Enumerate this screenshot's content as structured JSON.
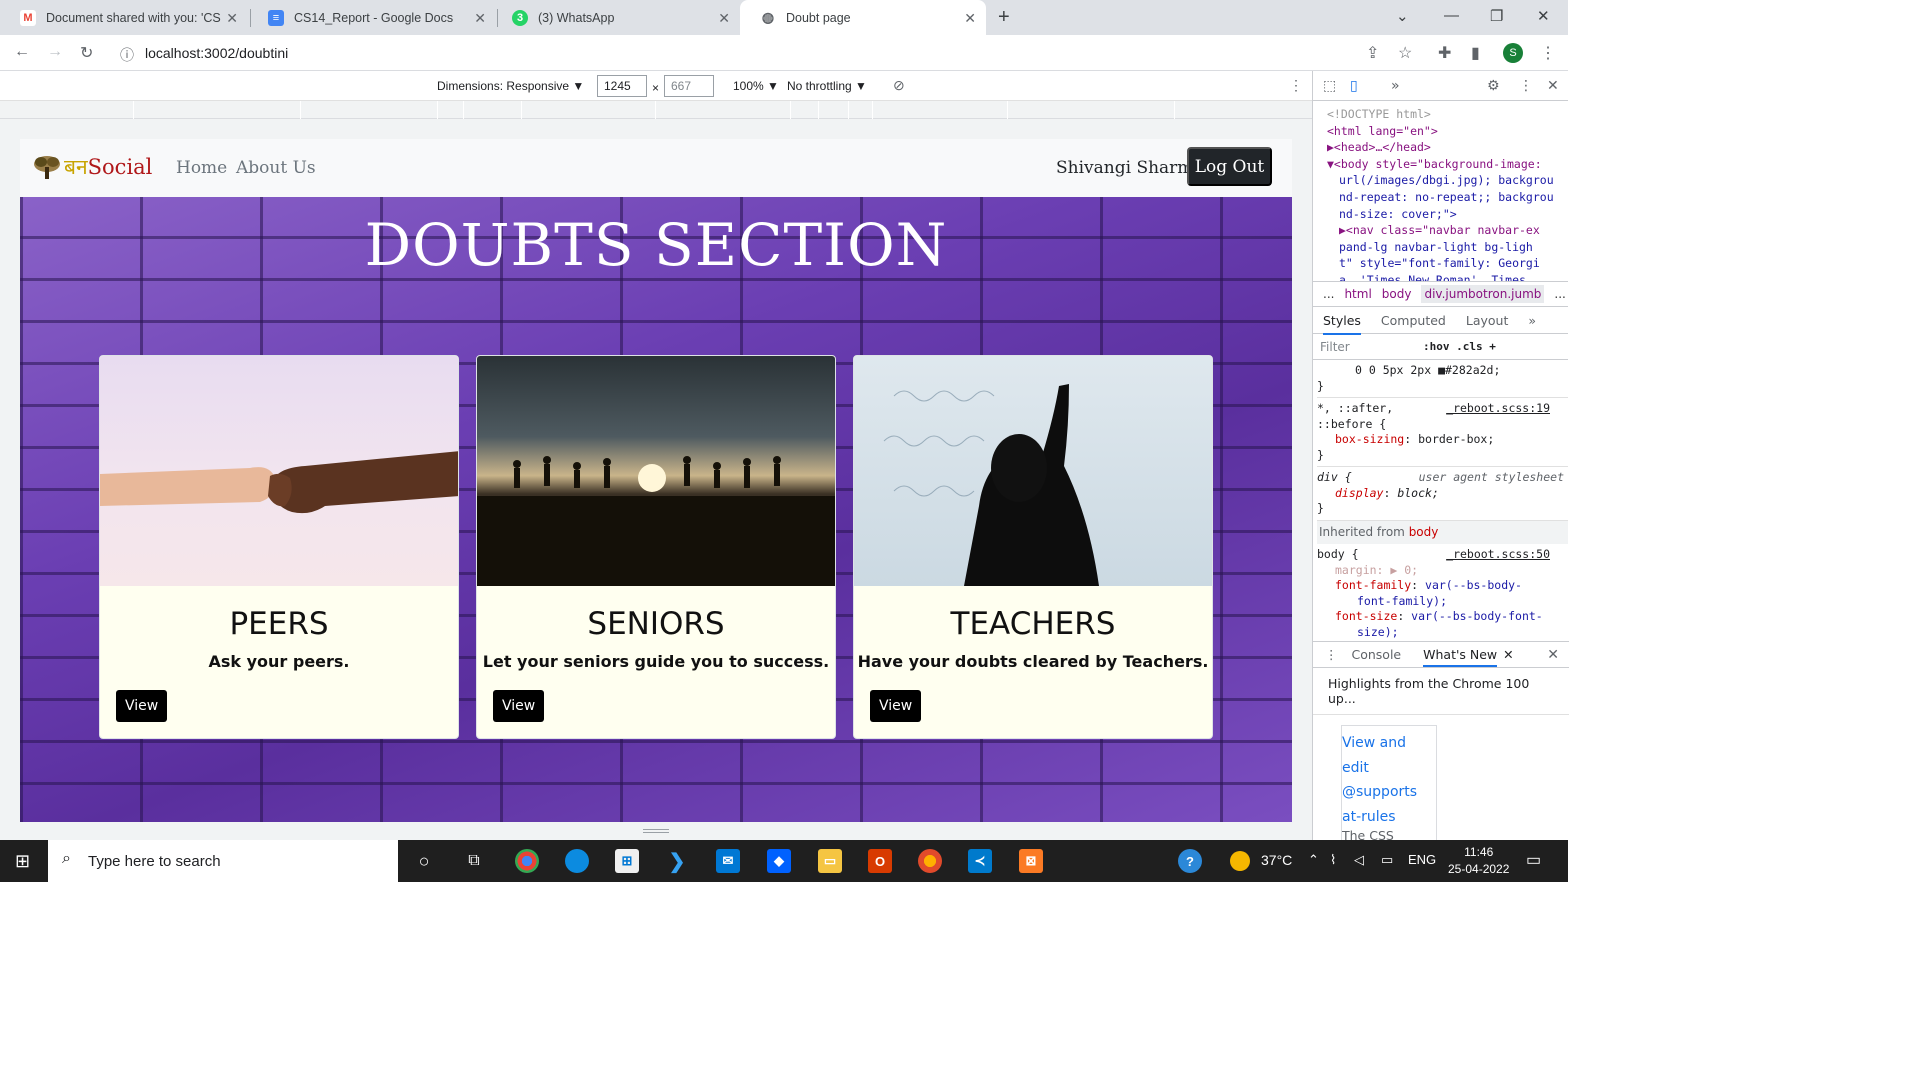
{
  "browser": {
    "tabs": [
      {
        "title": "Document shared with you: 'CS1",
        "icon": "gmail-icon",
        "color": "#ea4335",
        "glyph": "M"
      },
      {
        "title": "CS14_Report - Google Docs",
        "icon": "docs-icon",
        "color": "#4285f4",
        "glyph": "≡"
      },
      {
        "title": "(3) WhatsApp",
        "icon": "whatsapp-icon",
        "color": "#25d366",
        "glyph": "3"
      },
      {
        "title": "Doubt page",
        "icon": "globe-icon",
        "color": "#5f6368",
        "glyph": "◍"
      }
    ],
    "url": "localhost:3002/doubtini",
    "profile_initial": "S"
  },
  "device_toolbar": {
    "dimensions": "Dimensions: Responsive ▼",
    "width": "1245",
    "height": "667",
    "zoom": "100% ▼",
    "throttle": "No throttling ▼"
  },
  "site": {
    "brand_hindi": "बन",
    "brand_text": "Social",
    "nav": [
      "Home",
      "About Us"
    ],
    "username": "Shivangi Sharma",
    "logout_label": "Log Out",
    "hero_title": "DOUBTS SECTION",
    "cards": [
      {
        "title": "PEERS",
        "text": "Ask your peers.",
        "button": "View"
      },
      {
        "title": "SENIORS",
        "text": "Let your seniors guide you to success.",
        "button": "View"
      },
      {
        "title": "TEACHERS",
        "text": "Have your doubts cleared by Teachers.",
        "button": "View"
      }
    ]
  },
  "devtools": {
    "dom_lines": [
      "<!DOCTYPE html>",
      "<html lang=\"en\">",
      "▶<head>…</head>",
      "▼<body style=\"background-image:",
      "url(/images/dbgi.jpg); backgrou",
      "nd-repeat: no-repeat;; backgrou",
      "nd-size: cover;\">",
      "▶<nav class=\"navbar  navbar-ex",
      "pand-lg navbar-light bg-ligh",
      "t\" style=\"font-family: Georgi",
      "a, 'Times New Roman', Times,"
    ],
    "breadcrumbs": [
      "...",
      "html",
      "body",
      "div.jumbotron.jumb",
      "..."
    ],
    "subtabs": [
      "Styles",
      "Computed",
      "Layout",
      "»"
    ],
    "filter_placeholder": "Filter",
    "filter_tools": ":hov  .cls  +",
    "style_lines": {
      "shadow": "0 0 5px 2px ■#282a2d;",
      "rule1_selector": "*, ::after,",
      "rule1_selector2": "::before {",
      "rule1_source": "_reboot.scss:19",
      "rule1_prop": "box-sizing",
      "rule1_val": "border-box;",
      "rule2_selector": "div {",
      "rule2_source": "user agent stylesheet",
      "rule2_prop": "display",
      "rule2_val": "block;",
      "inherited_label": "Inherited from",
      "inherited_from": "body",
      "rule3_selector": "body {",
      "rule3_source": "_reboot.scss:50",
      "rule3_margin": "margin: ▶ 0;",
      "rule3_ff": "font-family",
      "rule3_ff_val": "var(--bs-body-",
      "rule3_ff_val2": "font-family);",
      "rule3_fs": "font-size",
      "rule3_fs_val": "var(--bs-body-font-",
      "rule3_fs_val2": "size);"
    },
    "drawer_tabs": [
      "Console",
      "What's New"
    ],
    "drawer_headline": "Highlights from the Chrome 100 up...",
    "whatsnew_link": "View and edit @supports at-rules",
    "whatsnew_body": "The CSS @supports at-rules are now displayed and"
  },
  "taskbar": {
    "search_placeholder": "Type here to search",
    "temperature": "37°C",
    "lang": "ENG",
    "time": "11:46",
    "date": "25-04-2022"
  }
}
